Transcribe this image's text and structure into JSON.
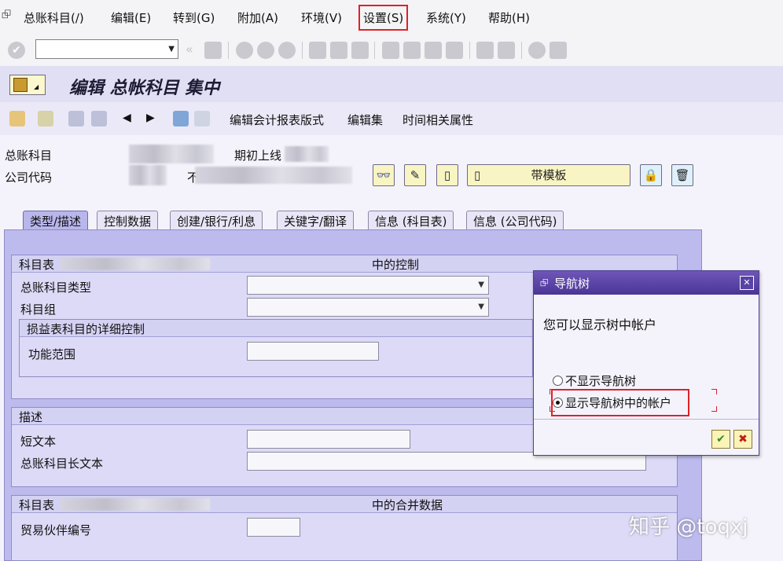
{
  "menubar": {
    "items": [
      {
        "label": "总账科目(/)",
        "highlighted": false
      },
      {
        "label": "编辑(E)",
        "highlighted": false
      },
      {
        "label": "转到(G)",
        "highlighted": false
      },
      {
        "label": "附加(A)",
        "highlighted": false
      },
      {
        "label": "环境(V)",
        "highlighted": false
      },
      {
        "label": "设置(S)",
        "highlighted": true
      },
      {
        "label": "系统(Y)",
        "highlighted": false
      },
      {
        "label": "帮助(H)",
        "highlighted": false
      }
    ]
  },
  "toolbar": {
    "command_field_value": "",
    "icons": [
      "enter-icon",
      "command-dropdown-icon",
      "back-nav-icon",
      "save-icon",
      "back-icon",
      "exit-icon",
      "cancel-icon",
      "print-icon",
      "find-icon",
      "find-next-icon",
      "first-page-icon",
      "previous-page-icon",
      "next-page-icon",
      "last-page-icon",
      "new-session-icon",
      "shortcut-icon",
      "help-icon",
      "layout-icon"
    ]
  },
  "title": {
    "text": "编辑 总帐科目 集中"
  },
  "app_toolbar": {
    "links": [
      "编辑会计报表版式",
      "编辑集",
      "时间相关属性"
    ]
  },
  "header_fields": {
    "account_label": "总账科目",
    "period_label": "期初上线",
    "company_label": "公司代码",
    "company_partial": "不",
    "template_button": "带模板"
  },
  "tabs": [
    {
      "label": "类型/描述",
      "active": true
    },
    {
      "label": "控制数据",
      "active": false
    },
    {
      "label": "创建/银行/利息",
      "active": false
    },
    {
      "label": "关键字/翻译",
      "active": false
    },
    {
      "label": "信息 (科目表)",
      "active": false
    },
    {
      "label": "信息 (公司代码)",
      "active": false
    }
  ],
  "control_group": {
    "title_prefix": "科目表",
    "title_suffix": "中的控制",
    "account_type_label": "总账科目类型",
    "account_group_label": "科目组",
    "pl_detail_title": "损益表科目的详细控制",
    "functional_area_label": "功能范围"
  },
  "description_group": {
    "title": "描述",
    "short_text_label": "短文本",
    "long_text_label": "总账科目长文本"
  },
  "consolidation_group": {
    "title_prefix": "科目表",
    "title_suffix": "中的合并数据",
    "trading_partner_label": "贸易伙伴编号"
  },
  "dialog": {
    "title": "导航树",
    "message": "您可以显示树中帐户",
    "options": [
      {
        "label": "不显示导航树",
        "selected": false
      },
      {
        "label": "显示导航树中的帐户",
        "selected": true
      }
    ],
    "confirm_icon": "checkmark-icon",
    "cancel_icon": "cross-icon"
  },
  "watermark": "知乎 @toqxj",
  "colors": {
    "title_band": "#e1dff3",
    "tab_active": "#b9b6ec",
    "dialog_title": "#4a3595",
    "highlight": "#e0202a"
  }
}
